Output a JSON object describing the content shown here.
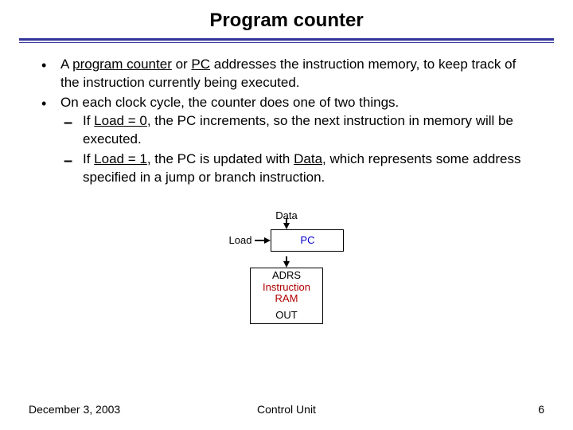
{
  "title": "Program counter",
  "bullets": {
    "b1_pre": "A ",
    "b1_pc_long": "program counter",
    "b1_mid": " or ",
    "b1_pc_short": "PC",
    "b1_post": " addresses the instruction memory, to keep track of the instruction currently being executed.",
    "b2": "On each clock cycle, the counter does one of two things.",
    "d1_pre": "If ",
    "d1_cond": "Load = 0",
    "d1_post": ", the PC increments, so the next instruction in memory will be executed.",
    "d2_pre": "If ",
    "d2_cond": "Load = 1",
    "d2_mid1": ", the PC is updated with ",
    "d2_data": "Data",
    "d2_post": ", which represents some address specified in a jump or branch instruction."
  },
  "diagram": {
    "data": "Data",
    "load": "Load",
    "pc": "PC",
    "adrs": "ADRS",
    "ram": "Instruction RAM",
    "out": "OUT"
  },
  "footer": {
    "date": "December 3, 2003",
    "center": "Control Unit",
    "page": "6"
  }
}
